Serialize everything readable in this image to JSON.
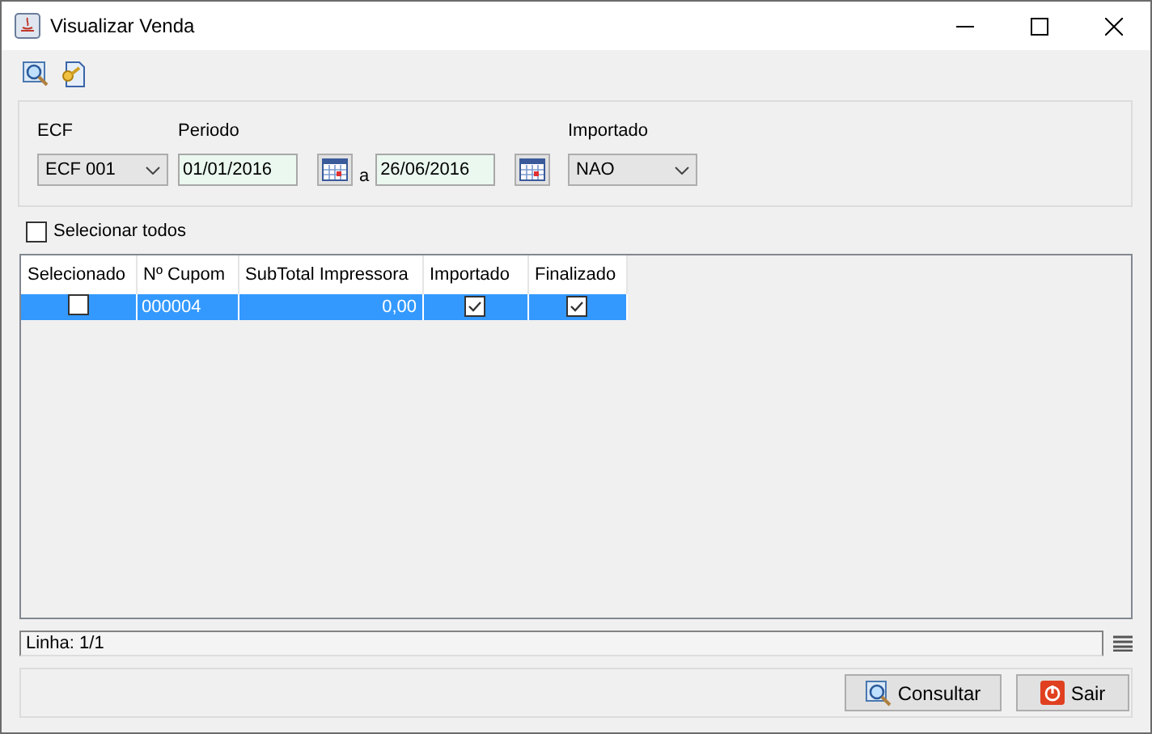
{
  "window": {
    "title": "Visualizar Venda"
  },
  "filters": {
    "ecf": {
      "label": "ECF",
      "value": "ECF 001"
    },
    "periodo": {
      "label": "Periodo",
      "from": "01/01/2016",
      "separator": "a",
      "to": "26/06/2016"
    },
    "importado": {
      "label": "Importado",
      "value": "NAO"
    }
  },
  "select_all": {
    "label": "Selecionar todos",
    "checked": false
  },
  "table": {
    "columns": [
      "Selecionado",
      "Nº Cupom",
      "SubTotal Impressora",
      "Importado",
      "Finalizado"
    ],
    "rows": [
      {
        "selected": true,
        "cells": [
          {
            "kind": "check",
            "checked": false
          },
          {
            "kind": "text",
            "text": "000004"
          },
          {
            "kind": "number",
            "text": "0,00"
          },
          {
            "kind": "check",
            "checked": true
          },
          {
            "kind": "check",
            "checked": true
          }
        ]
      }
    ]
  },
  "status_bar": {
    "text": "Linha: 1/1"
  },
  "buttons": [
    {
      "label": "Consultar",
      "kind": "search"
    },
    {
      "label": "Sair",
      "kind": "exit"
    }
  ]
}
